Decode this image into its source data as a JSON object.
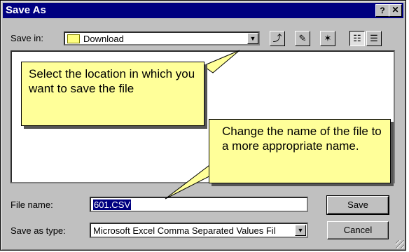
{
  "dialog": {
    "title": "Save As",
    "help_label": "?",
    "close_label": "✕"
  },
  "save_in": {
    "label": "Save in:",
    "value": "Download",
    "icon": "folder-icon"
  },
  "toolbar": {
    "up_icon": "up-one-level-icon",
    "desktop_icon": "desktop-icon",
    "new_folder_icon": "new-folder-icon",
    "list_icon": "list-view-icon",
    "details_icon": "details-view-icon"
  },
  "callouts": {
    "location": "Select the location in which you want to save the file",
    "name": "Change the name of the file to a more appropriate name."
  },
  "file_name": {
    "label": "File name:",
    "value": "601.CSV"
  },
  "save_as_type": {
    "label": "Save as type:",
    "value": "Microsoft Excel Comma Separated Values Fil"
  },
  "buttons": {
    "save": "Save",
    "cancel": "Cancel"
  }
}
